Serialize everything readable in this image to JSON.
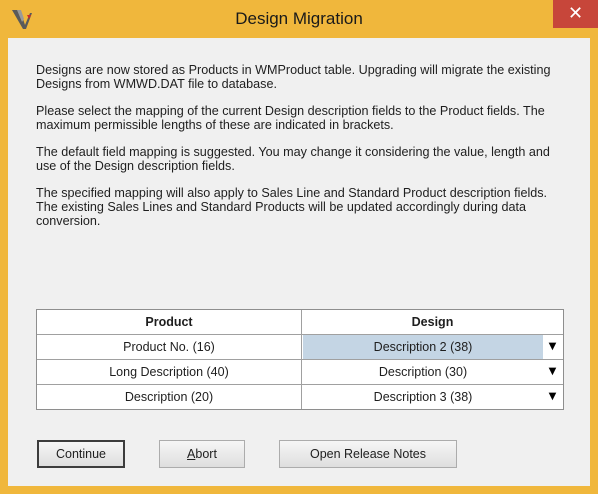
{
  "window": {
    "title": "Design Migration",
    "close_glyph": "✕",
    "app_icon": "application-logo-icon"
  },
  "intro": {
    "p1": "Designs are now stored as Products in WMProduct table. Upgrading will migrate the existing Designs from WMWD.DAT file to database.",
    "p2": "Please select the mapping of the current Design description fields to the Product fields. The maximum permissible lengths of these are indicated in brackets.",
    "p3": "The default field mapping is suggested. You may change it considering the value, length and use of the Design description fields.",
    "p4": "The specified mapping will also apply to Sales Line and Standard Product description fields. The existing Sales Lines and Standard Products will be updated accordingly during data conversion."
  },
  "mapping": {
    "headers": {
      "product": "Product",
      "design": "Design"
    },
    "rows": [
      {
        "product": "Product No. (16)",
        "design": "Description 2 (38)",
        "selected": true
      },
      {
        "product": "Long Description (40)",
        "design": "Description (30)",
        "selected": false
      },
      {
        "product": "Description (20)",
        "design": "Description 3 (38)",
        "selected": false
      }
    ],
    "dropdown_glyph": "▼"
  },
  "buttons": {
    "continue": "Continue",
    "abort_mnemonic": "A",
    "abort_rest": "bort",
    "release_notes": "Open Release Notes"
  },
  "colors": {
    "title_bar": "#f0b73c",
    "close_button": "#c7463a",
    "selected_cell": "#c4d5e4"
  }
}
